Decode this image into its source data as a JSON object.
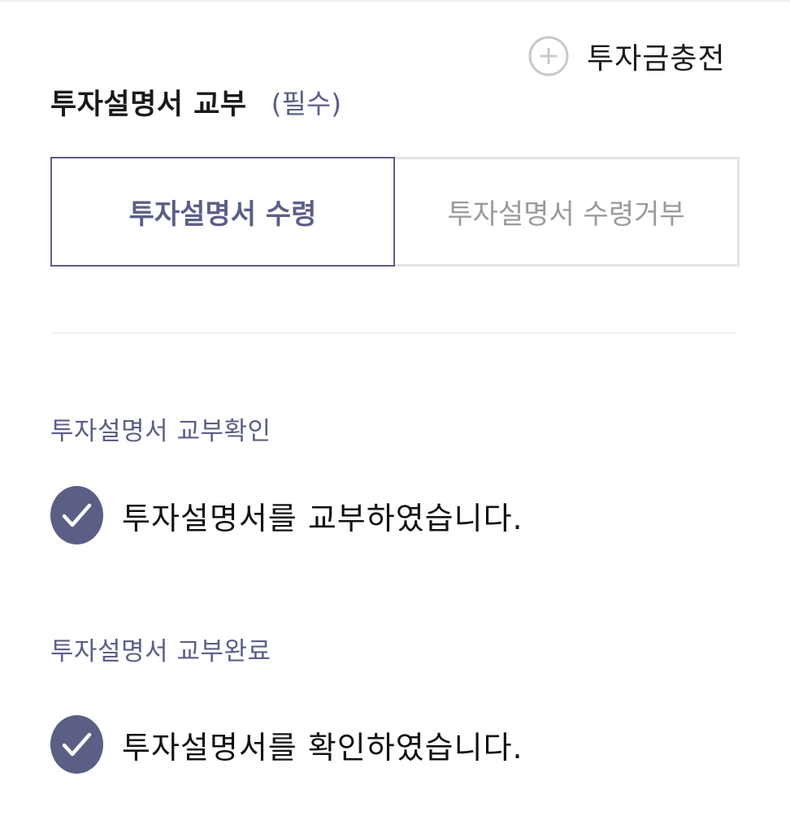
{
  "header": {
    "charge_label": "투자금충전",
    "charge_icon": "plus-circle-icon"
  },
  "section": {
    "title": "투자설명서 교부",
    "required": "(필수)"
  },
  "segmented": {
    "options": [
      {
        "label": "투자설명서 수령",
        "selected": true
      },
      {
        "label": "투자설명서 수령거부",
        "selected": false
      }
    ]
  },
  "confirm_delivery": {
    "label": "투자설명서 교부확인",
    "check_text": "투자설명서를 교부하였습니다.",
    "checked": true,
    "icon": "check-circle-icon"
  },
  "confirm_complete": {
    "label": "투자설명서 교부완료",
    "check_text": "투자설명서를 확인하였습니다.",
    "checked": true,
    "icon": "check-circle-icon"
  },
  "colors": {
    "accent": "#5b5f86",
    "unselected_text": "#9a9a9f",
    "unselected_border": "#e3e3e6",
    "text": "#111111",
    "divider": "#efeff1"
  }
}
